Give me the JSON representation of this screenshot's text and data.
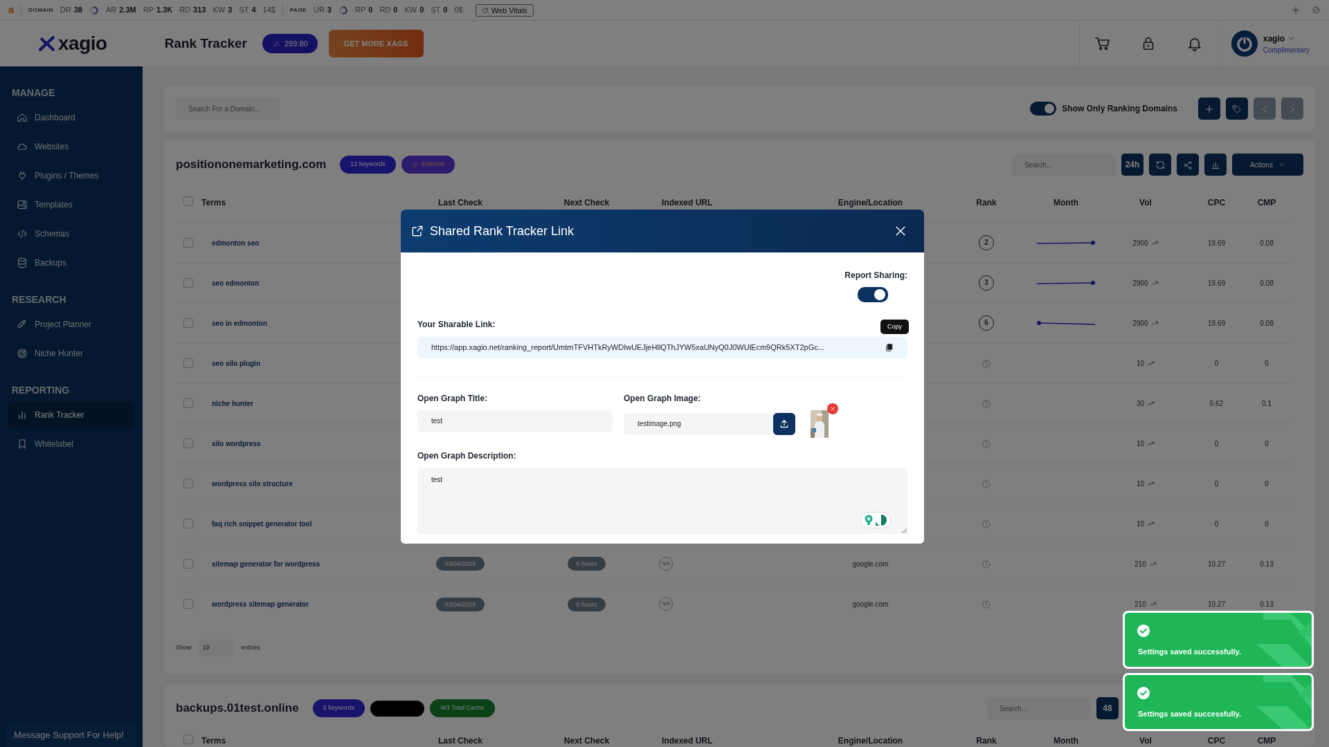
{
  "extension_bar": {
    "logo": "a",
    "domain_label": "DOMAIN",
    "domain_metrics": [
      {
        "label": "DR",
        "value": "38"
      },
      {
        "label": "AR",
        "value": "2.3M"
      },
      {
        "label": "RP",
        "value": "1.3K"
      },
      {
        "label": "RD",
        "value": "313"
      },
      {
        "label": "KW",
        "value": "3"
      },
      {
        "label": "ST",
        "value": "4"
      }
    ],
    "domain_cost": "14$",
    "page_label": "PAGE",
    "page_metrics": [
      {
        "label": "UR",
        "value": "3"
      },
      {
        "label": "RP",
        "value": "0"
      },
      {
        "label": "RD",
        "value": "0"
      },
      {
        "label": "KW",
        "value": "0"
      },
      {
        "label": "ST",
        "value": "0"
      }
    ],
    "page_cost": "0$",
    "web_vitals": "Web Vitals"
  },
  "header": {
    "brand": "xagio",
    "page_title": "Rank Tracker",
    "xags": "299.80",
    "get_more": "GET MORE XAGS",
    "user": {
      "name": "xagio",
      "plan": "Complimentary"
    }
  },
  "sidebar": {
    "sections": [
      {
        "title": "MANAGE",
        "items": [
          {
            "label": "Dashboard",
            "selected": false
          },
          {
            "label": "Websites",
            "selected": false
          },
          {
            "label": "Plugins / Themes",
            "selected": false
          },
          {
            "label": "Templates",
            "selected": false
          },
          {
            "label": "Schemas",
            "selected": false
          },
          {
            "label": "Backups",
            "selected": false
          }
        ]
      },
      {
        "title": "RESEARCH",
        "items": [
          {
            "label": "Project Planner",
            "selected": false
          },
          {
            "label": "Niche Hunter",
            "selected": false
          }
        ]
      },
      {
        "title": "REPORTING",
        "items": [
          {
            "label": "Rank Tracker",
            "selected": true
          },
          {
            "label": "Whitelabel",
            "selected": false
          }
        ]
      }
    ],
    "support": "Message Support For Help!"
  },
  "filter_bar": {
    "search_placeholder": "Search For a Domain...",
    "show_only_ranking": {
      "label": "Show Only Ranking Domains",
      "on": true
    }
  },
  "domains": [
    {
      "name": "positiononemarketing.com",
      "tags": [
        {
          "kind": "count",
          "text": "12 keywords"
        },
        {
          "kind": "external",
          "text": "External"
        }
      ],
      "search_placeholder": "Search...",
      "period": "24h",
      "actions": "Actions",
      "columns": [
        "Terms",
        "Last Check",
        "Next Check",
        "Indexed URL",
        "Engine/Location",
        "Rank",
        "Month",
        "Vol",
        "CPC",
        "CMP"
      ],
      "all_checked": false,
      "rows": [
        {
          "term": "edmonton seo",
          "checked": false,
          "rank": "2",
          "sparkline": true,
          "vol": "2900",
          "cpc": "19.69",
          "cmp": "0.08"
        },
        {
          "term": "seo edmonton",
          "checked": false,
          "rank": "3",
          "sparkline": true,
          "vol": "2900",
          "cpc": "19.69",
          "cmp": "0.08"
        },
        {
          "term": "seo in edmonton",
          "checked": false,
          "rank": "6",
          "sparkline": true,
          "vol": "2900",
          "cpc": "19.69",
          "cmp": "0.08"
        },
        {
          "term": "seo silo plugin",
          "checked": false,
          "vol": "10",
          "cpc": "0",
          "cmp": "0"
        },
        {
          "term": "niche hunter",
          "checked": false,
          "vol": "30",
          "cpc": "5.62",
          "cmp": "0.1"
        },
        {
          "term": "silo wordpress",
          "checked": false,
          "vol": "10",
          "cpc": "0",
          "cmp": "0"
        },
        {
          "term": "wordpress silo structure",
          "checked": false,
          "vol": "10",
          "cpc": "0",
          "cmp": "0"
        },
        {
          "term": "faq rich snippet generator tool",
          "checked": false,
          "vol": "10",
          "cpc": "0",
          "cmp": "0"
        },
        {
          "term": "sitemap generator for wordpress",
          "checked": false,
          "last_check": "03/04/2025",
          "next_check": "6 hours",
          "indexed_url": "N/A",
          "engine": "google.com",
          "vol": "210",
          "cpc": "10.27",
          "cmp": "0.13"
        },
        {
          "term": "wordpress sitemap generator",
          "checked": false,
          "last_check": "03/04/2025",
          "next_check": "6 hours",
          "indexed_url": "N/A",
          "engine": "google.com",
          "vol": "210",
          "cpc": "10.27",
          "cmp": "0.13"
        }
      ],
      "show": "Show",
      "page_size": "10",
      "entries": "entries"
    },
    {
      "name": "backups.01test.online",
      "tags": [
        {
          "kind": "count",
          "text": "5 keywords"
        },
        {
          "kind": "redacted"
        },
        {
          "kind": "plugin",
          "text": "W3 Total Cache"
        }
      ],
      "search_placeholder": "Search...",
      "period": "48",
      "columns": [
        "Terms",
        "Last Check",
        "Next Check",
        "Indexed URL",
        "Engine/Location",
        "Rank",
        "Month",
        "Vol",
        "CPC",
        "CMP"
      ],
      "all_checked": false
    }
  ],
  "modal": {
    "title": "Shared Rank Tracker Link",
    "report_sharing": {
      "label": "Report Sharing:",
      "on": true
    },
    "link_label": "Your Sharable Link:",
    "link": "https://app.xagio.net/ranking_report/UmtmTFVHTkRyWDIwUEJjeHllQThJYW5xaUNyQ0J0WUlEcm9QRk5XT2pGc...",
    "copy_tooltip": "Copy",
    "og_title_label": "Open Graph Title:",
    "og_title": "test",
    "og_image_label": "Open Graph Image:",
    "og_image": "testimage.png",
    "og_description_label": "Open Graph Description:",
    "og_description": "test"
  },
  "toasts": [
    {
      "message": "Settings saved successfully."
    },
    {
      "message": "Settings saved successfully."
    }
  ]
}
